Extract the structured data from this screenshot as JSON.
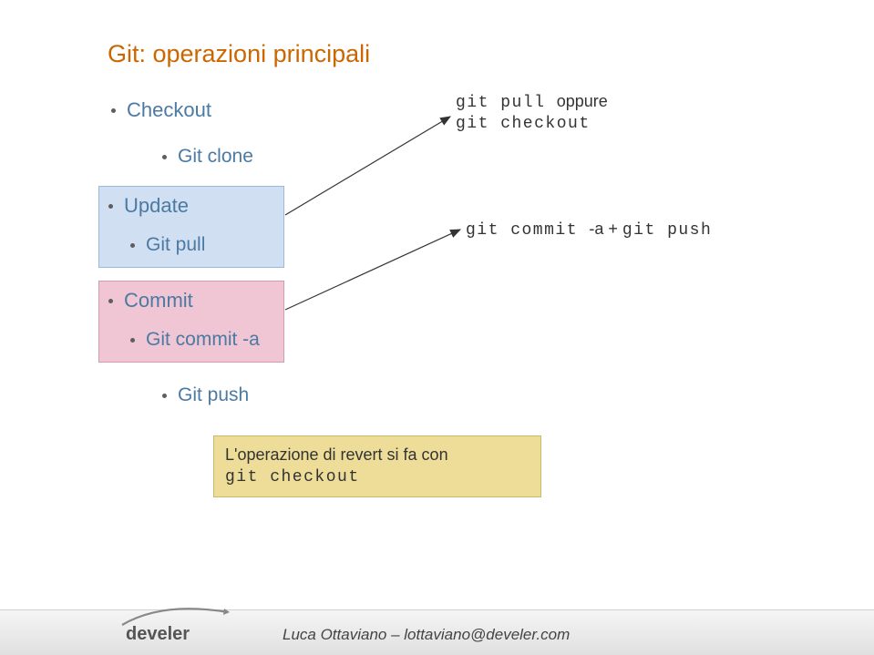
{
  "title": "Git: operazioni principali",
  "items": {
    "checkout": "Checkout",
    "git_clone": "Git clone",
    "update": "Update",
    "git_pull": "Git pull",
    "commit": "Commit",
    "git_commit_a": "Git commit -a",
    "git_push": "Git push"
  },
  "annotations": {
    "top_line1_pre": "git pull ",
    "top_line1_word": "oppure",
    "top_line2": "git checkout",
    "mid_pre": "git commit ",
    "mid_mid": "-a + ",
    "mid_post": "git push"
  },
  "revert_box": {
    "line1": "L'operazione di revert si fa con",
    "line2": "git checkout"
  },
  "footer": "Luca Ottaviano – lottaviano@develer.com",
  "logo_text": "develer"
}
